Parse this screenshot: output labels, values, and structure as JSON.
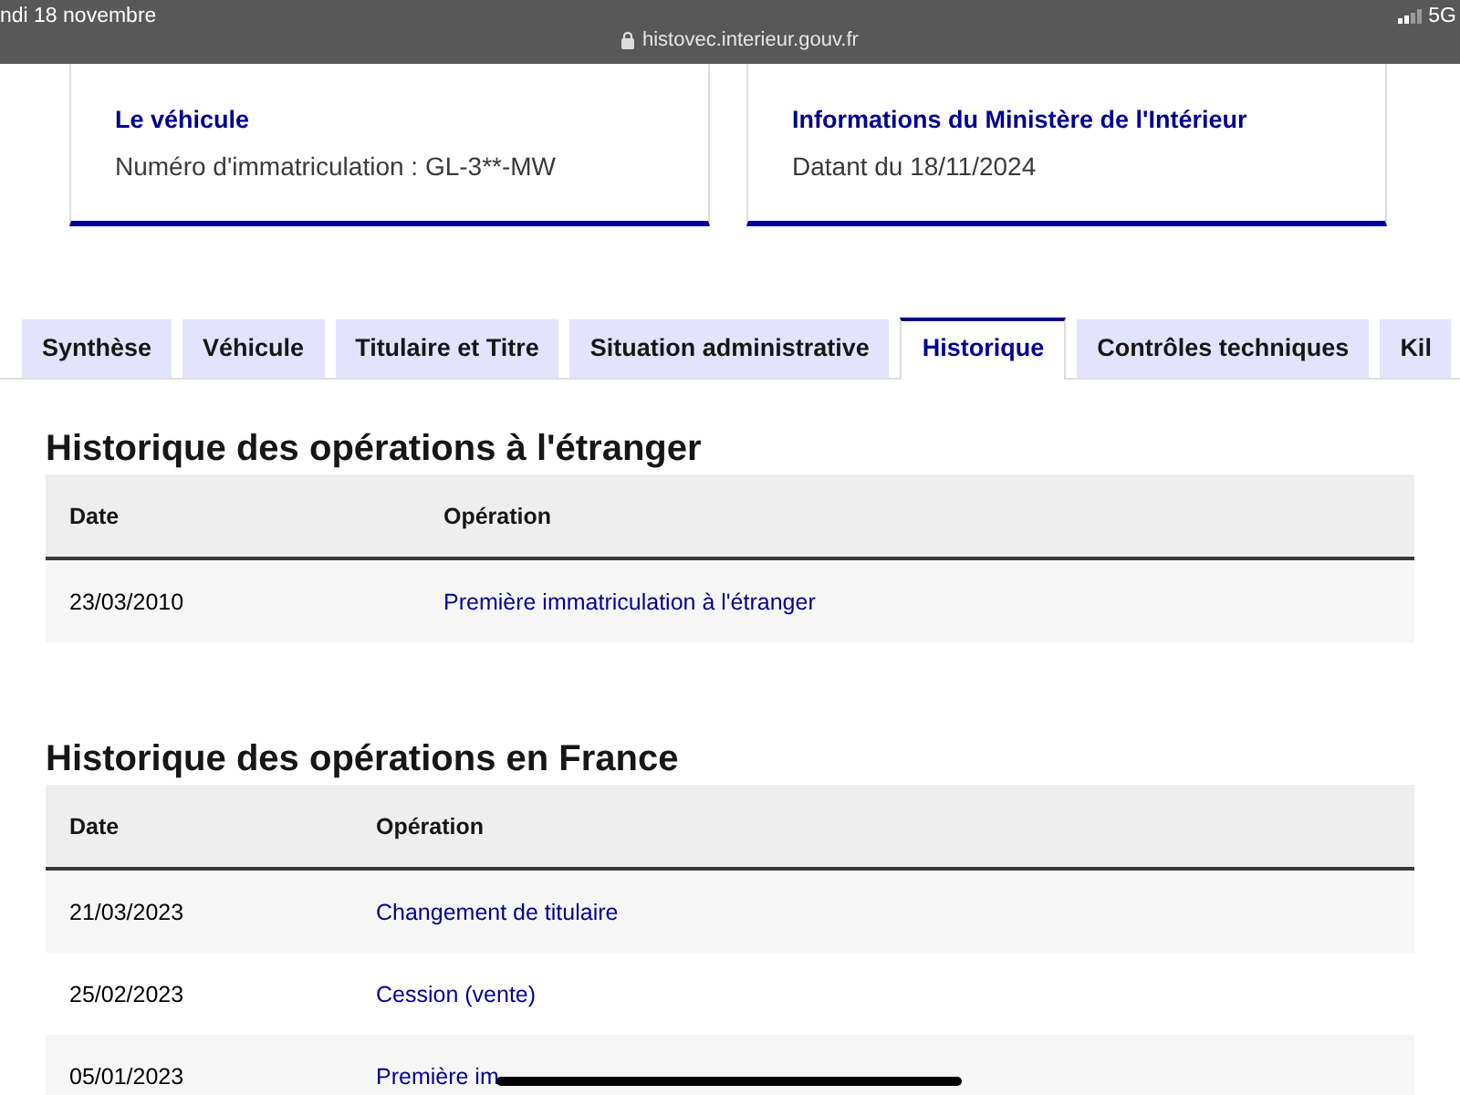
{
  "status_bar": {
    "date": "ndi 18 novembre",
    "url": "histovec.interieur.gouv.fr",
    "network": "5G"
  },
  "cards": [
    {
      "title": "Le véhicule",
      "text": "Numéro d'immatriculation : GL-3**-MW"
    },
    {
      "title": "Informations du Ministère de l'Intérieur",
      "text": "Datant du 18/11/2024"
    }
  ],
  "tabs": [
    {
      "label": "Synthèse",
      "selected": false
    },
    {
      "label": "Véhicule",
      "selected": false
    },
    {
      "label": "Titulaire et Titre",
      "selected": false
    },
    {
      "label": "Situation administrative",
      "selected": false
    },
    {
      "label": "Historique",
      "selected": true
    },
    {
      "label": "Contrôles techniques",
      "selected": false
    },
    {
      "label": "Kil",
      "selected": false
    }
  ],
  "sections": [
    {
      "title": "Historique des opérations à l'étranger",
      "columns": [
        "Date",
        "Opération"
      ],
      "rows": [
        [
          "23/03/2010",
          "Première immatriculation à l'étranger"
        ]
      ]
    },
    {
      "title": "Historique des opérations en France",
      "columns": [
        "Date",
        "Opération"
      ],
      "rows": [
        [
          "21/03/2023",
          "Changement de titulaire"
        ],
        [
          "25/02/2023",
          "Cession (vente)"
        ],
        [
          "05/01/2023",
          "Première im"
        ]
      ]
    }
  ]
}
